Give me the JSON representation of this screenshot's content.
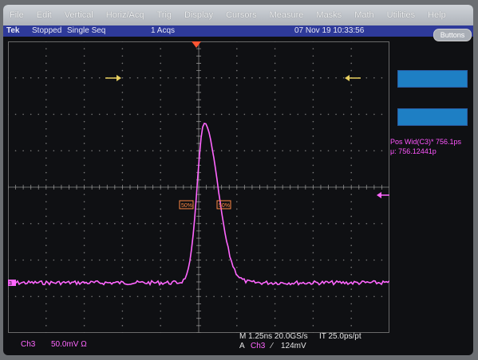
{
  "menu": [
    "File",
    "Edit",
    "Vertical",
    "Horiz/Acq",
    "Trig",
    "Display",
    "Cursors",
    "Measure",
    "Masks",
    "Math",
    "Utilities",
    "Help"
  ],
  "status": {
    "logo": "Tek",
    "state": "Stopped",
    "mode": "Single Seq",
    "acqs": "1 Acqs",
    "datetime": "07 Nov 19 10:33:56"
  },
  "buttons_label": "Buttons",
  "measurement": {
    "line1": "Pos Wid(C3)* 756.1ps",
    "line2": "μ: 756.12441p"
  },
  "markers": {
    "pct_left": "50%",
    "pct_right": "50%",
    "channel_ref": "3"
  },
  "bottom": {
    "channel": "Ch3",
    "scale": "50.0mV Ω",
    "timebase": "M 1.25ns 20.0GS/s",
    "interval": "IT 25.0ps/pt",
    "trig_prefix": "A",
    "trig_channel": "Ch3",
    "trig_slope": "⁄",
    "trig_level": "124mV"
  },
  "colors": {
    "trace": "#ff66ff",
    "status_bar": "#2e3a9a",
    "trigger_marker": "#ff5533",
    "panel_box": "#1e7fc4"
  },
  "icons": [
    "cursor-arrow-left",
    "cursor-arrow-right",
    "trigger-position-marker",
    "trigger-level-arrow",
    "channel-ground-marker"
  ]
}
